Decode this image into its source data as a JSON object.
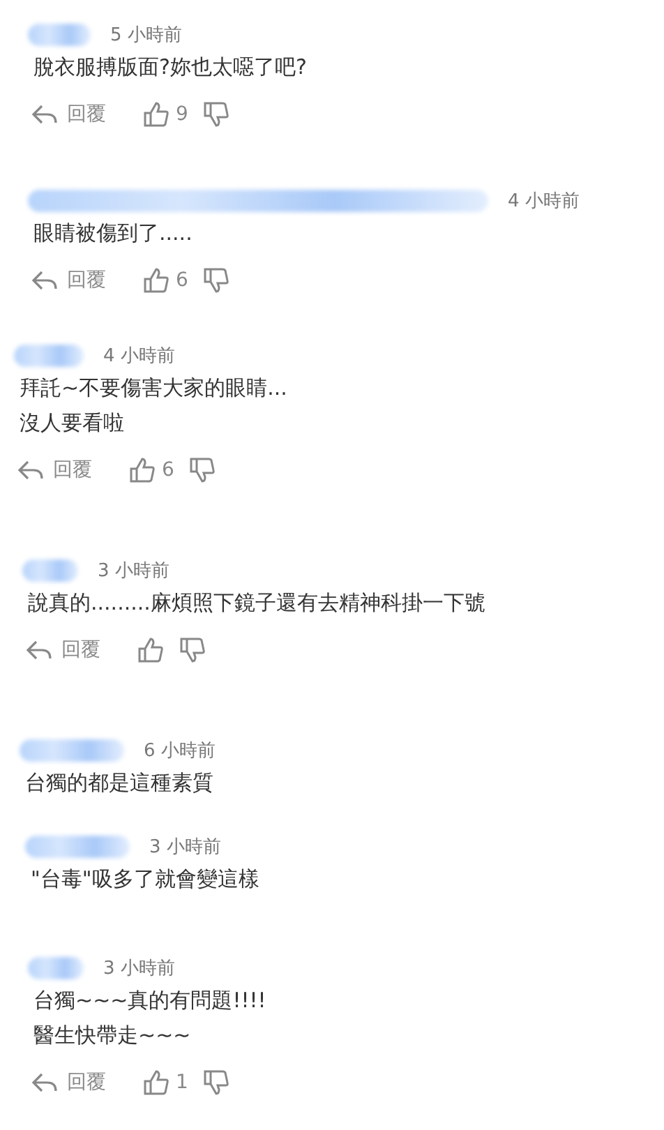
{
  "comments": [
    {
      "time": "5 小時前",
      "lines": [
        "脫衣服搏版面?妳也太噁了吧?"
      ],
      "actions": {
        "reply": "回覆",
        "likes": "9"
      }
    },
    {
      "time": "4 小時前",
      "lines": [
        "眼睛被傷到了....."
      ],
      "actions": {
        "reply": "回覆",
        "likes": "6"
      }
    },
    {
      "time": "4 小時前",
      "lines": [
        "拜託~不要傷害大家的眼睛...",
        "沒人要看啦"
      ],
      "actions": {
        "reply": "回覆",
        "likes": "6"
      }
    },
    {
      "time": "3 小時前",
      "lines": [
        "說真的.........麻煩照下鏡子還有去精神科掛一下號"
      ],
      "actions": {
        "reply": "回覆"
      }
    },
    {
      "time": "6 小時前",
      "lines": [
        "台獨的都是這種素質"
      ]
    },
    {
      "time": "3 小時前",
      "lines": [
        "\"台毒\"吸多了就會變這樣"
      ]
    },
    {
      "time": "3 小時前",
      "lines": [
        "台獨~~~真的有問題!!!!",
        "醫生快帶走~~~"
      ],
      "actions": {
        "reply": "回覆",
        "likes": "1"
      }
    }
  ]
}
